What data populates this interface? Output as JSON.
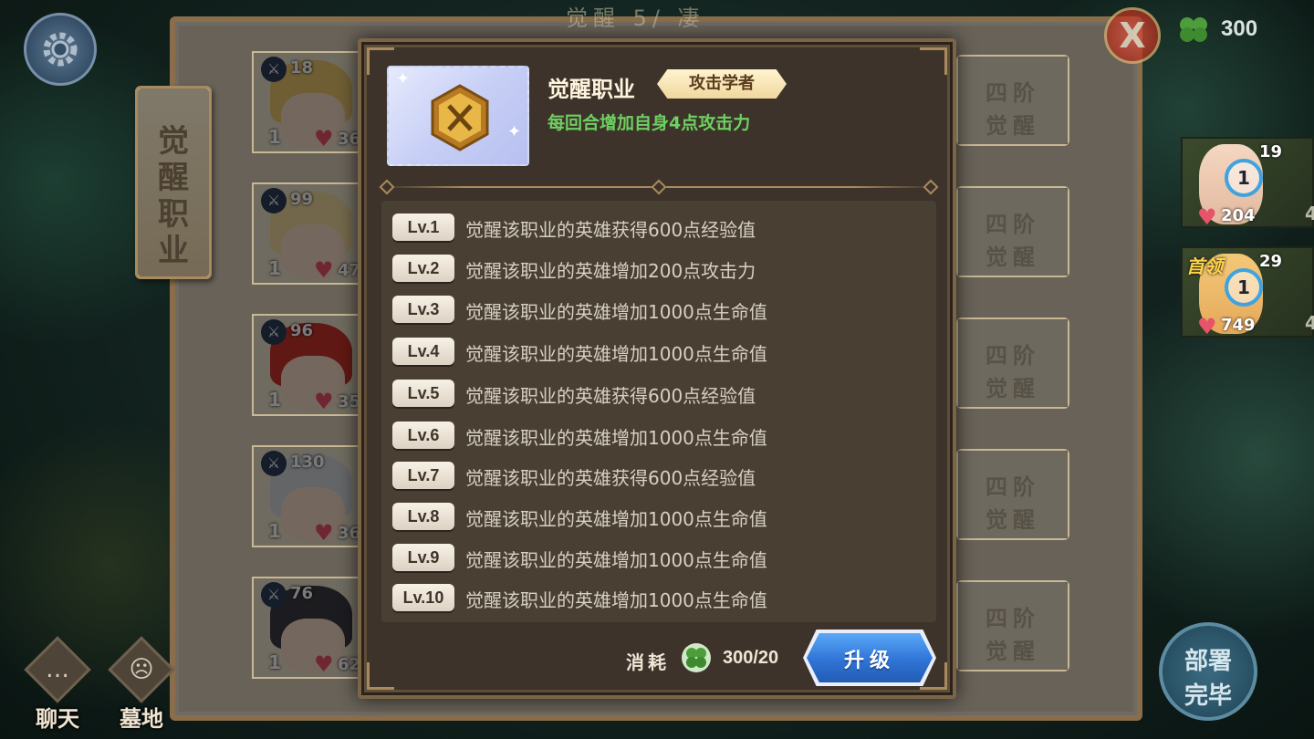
{
  "hud": {
    "currency_value": "300",
    "chat_label": "聊天",
    "graveyard_label": "墓地",
    "deploy_line1": "部署",
    "deploy_line2": "完毕",
    "close_label": "X",
    "icons": [
      "settings-gear-icon",
      "clover-gem-icon",
      "chat-icon",
      "graveyard-icon"
    ]
  },
  "background_panel": {
    "title": "觉醒 5/ 凄",
    "side_tab": [
      "觉",
      "醒",
      "职",
      "业"
    ],
    "awaken_label_line1": "四阶",
    "awaken_label_line2": "觉醒",
    "heroes": [
      {
        "level": "18",
        "star": "1",
        "hp": "36",
        "hair": "#e8c46e"
      },
      {
        "level": "99",
        "star": "1",
        "hp": "47",
        "hair": "#f0d79e"
      },
      {
        "level": "96",
        "star": "1",
        "hp": "35",
        "hair": "#c8322a"
      },
      {
        "level": "130",
        "star": "1",
        "hp": "36",
        "hair": "#cfd3d8"
      },
      {
        "level": "76",
        "star": "1",
        "hp": "62",
        "hair": "#3c3c44"
      }
    ]
  },
  "party": [
    {
      "level": "19",
      "ring": "1",
      "hp": "204",
      "count": "4",
      "tag": ""
    },
    {
      "level": "29",
      "ring": "1",
      "hp": "749",
      "count": "4",
      "tag": "首领"
    }
  ],
  "modal": {
    "title": "觉醒职业",
    "job_tag": "攻击学者",
    "description": "每回合增加自身4点攻击力",
    "levels": [
      {
        "lv": "Lv.1",
        "text": "觉醒该职业的英雄获得600点经验值"
      },
      {
        "lv": "Lv.2",
        "text": "觉醒该职业的英雄增加200点攻击力"
      },
      {
        "lv": "Lv.3",
        "text": "觉醒该职业的英雄增加1000点生命值"
      },
      {
        "lv": "Lv.4",
        "text": "觉醒该职业的英雄增加1000点生命值"
      },
      {
        "lv": "Lv.5",
        "text": "觉醒该职业的英雄获得600点经验值"
      },
      {
        "lv": "Lv.6",
        "text": "觉醒该职业的英雄增加1000点生命值"
      },
      {
        "lv": "Lv.7",
        "text": "觉醒该职业的英雄获得600点经验值"
      },
      {
        "lv": "Lv.8",
        "text": "觉醒该职业的英雄增加1000点生命值"
      },
      {
        "lv": "Lv.9",
        "text": "觉醒该职业的英雄增加1000点生命值"
      },
      {
        "lv": "Lv.10",
        "text": "觉醒该职业的英雄增加1000点生命值"
      }
    ],
    "cost_label": "消耗",
    "cost_value": "300/20",
    "upgrade_label": "升级",
    "icons": [
      "crossed-swords-badge-icon",
      "clover-gem-icon"
    ]
  },
  "colors": {
    "accent_green": "#6ecf62",
    "upgrade_blue": "#2f74d6",
    "modal_bg": "#3d332a",
    "gold": "#e1a23b"
  }
}
